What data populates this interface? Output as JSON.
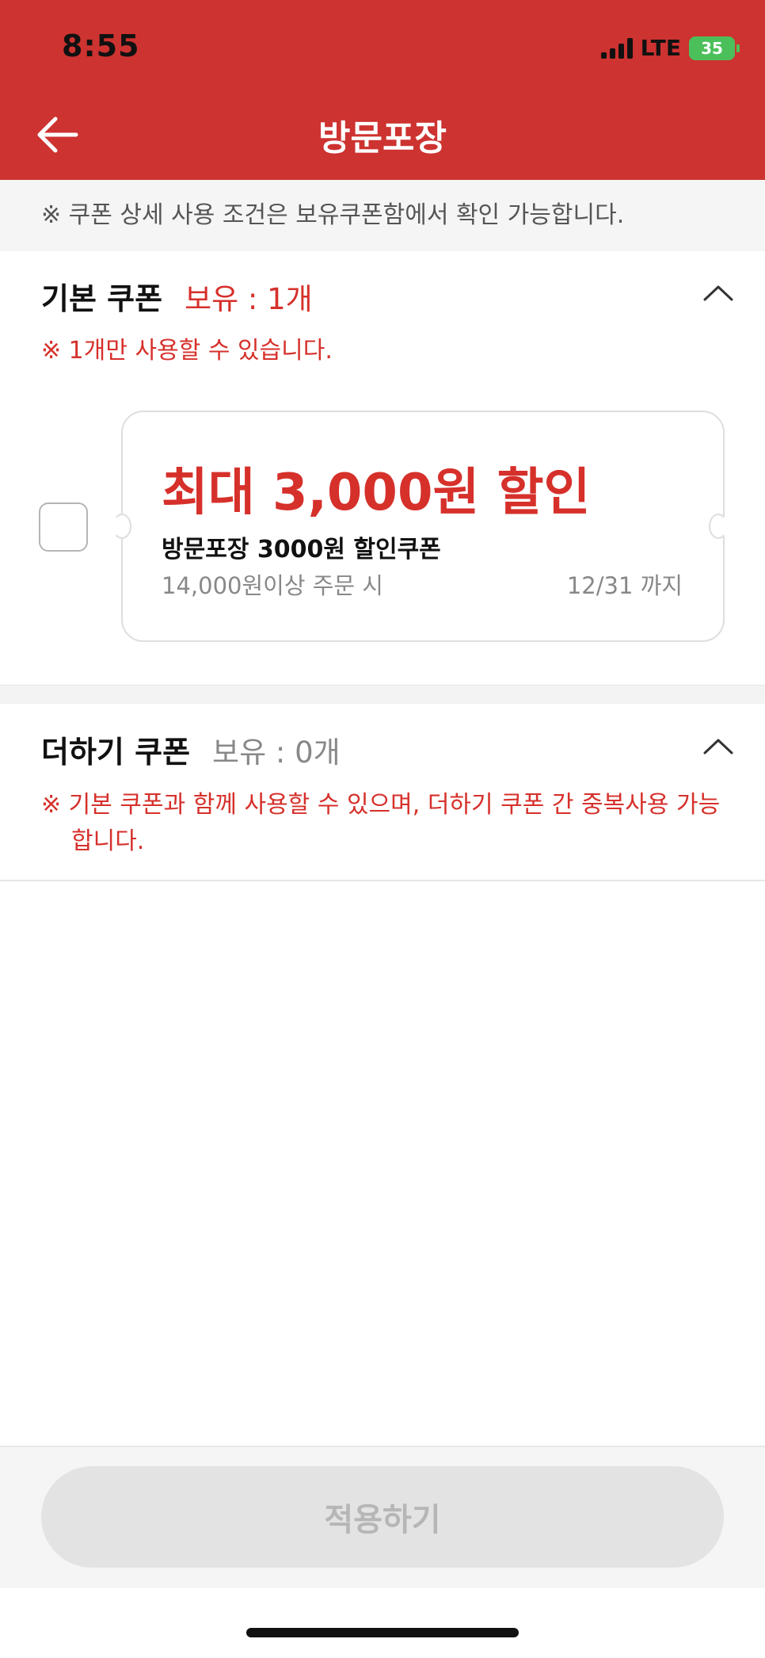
{
  "status_bar": {
    "time": "8:55",
    "network": "LTE",
    "battery": "35"
  },
  "header": {
    "title": "방문포장"
  },
  "notice": "※ 쿠폰 상세 사용 조건은 보유쿠폰함에서 확인 가능합니다.",
  "basic_coupons": {
    "title": "기본 쿠폰",
    "count": "보유 : 1개",
    "rule": "※ 1개만 사용할 수 있습니다.",
    "coupons": [
      {
        "amount": "최대 3,000원 할인",
        "name": "방문포장 3000원 할인쿠폰",
        "condition": "14,000원이상 주문 시",
        "expiry": "12/31 까지",
        "checked": false
      }
    ]
  },
  "plus_coupons": {
    "title": "더하기 쿠폰",
    "count": "보유 : 0개",
    "rule_line1": "※ 기본 쿠폰과 함께 사용할 수 있으며, 더하기 쿠폰 간 중복사용 가능",
    "rule_line2": "합니다."
  },
  "footer": {
    "apply_label": "적용하기",
    "apply_enabled": false
  },
  "colors": {
    "brand_red": "#cd3330",
    "accent_red": "#d6302b",
    "battery_green": "#4bc05a"
  },
  "icons": {
    "back": "arrow-left-icon",
    "collapse": "chevron-up-icon",
    "battery": "battery-charging-icon"
  }
}
